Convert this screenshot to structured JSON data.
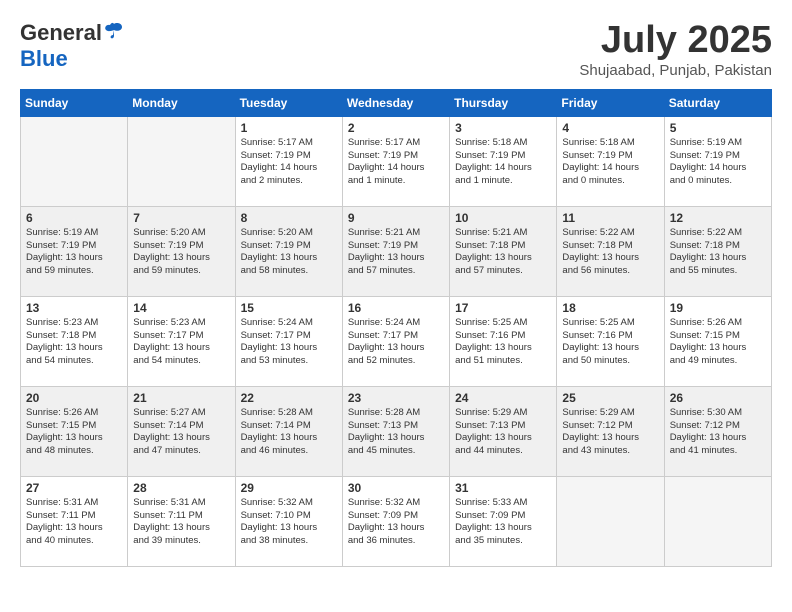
{
  "header": {
    "logo_line1": "General",
    "logo_line2": "Blue",
    "month_title": "July 2025",
    "location": "Shujaabad, Punjab, Pakistan"
  },
  "days_of_week": [
    "Sunday",
    "Monday",
    "Tuesday",
    "Wednesday",
    "Thursday",
    "Friday",
    "Saturday"
  ],
  "weeks": [
    [
      {
        "day": "",
        "info": ""
      },
      {
        "day": "",
        "info": ""
      },
      {
        "day": "1",
        "info": "Sunrise: 5:17 AM\nSunset: 7:19 PM\nDaylight: 14 hours\nand 2 minutes."
      },
      {
        "day": "2",
        "info": "Sunrise: 5:17 AM\nSunset: 7:19 PM\nDaylight: 14 hours\nand 1 minute."
      },
      {
        "day": "3",
        "info": "Sunrise: 5:18 AM\nSunset: 7:19 PM\nDaylight: 14 hours\nand 1 minute."
      },
      {
        "day": "4",
        "info": "Sunrise: 5:18 AM\nSunset: 7:19 PM\nDaylight: 14 hours\nand 0 minutes."
      },
      {
        "day": "5",
        "info": "Sunrise: 5:19 AM\nSunset: 7:19 PM\nDaylight: 14 hours\nand 0 minutes."
      }
    ],
    [
      {
        "day": "6",
        "info": "Sunrise: 5:19 AM\nSunset: 7:19 PM\nDaylight: 13 hours\nand 59 minutes."
      },
      {
        "day": "7",
        "info": "Sunrise: 5:20 AM\nSunset: 7:19 PM\nDaylight: 13 hours\nand 59 minutes."
      },
      {
        "day": "8",
        "info": "Sunrise: 5:20 AM\nSunset: 7:19 PM\nDaylight: 13 hours\nand 58 minutes."
      },
      {
        "day": "9",
        "info": "Sunrise: 5:21 AM\nSunset: 7:19 PM\nDaylight: 13 hours\nand 57 minutes."
      },
      {
        "day": "10",
        "info": "Sunrise: 5:21 AM\nSunset: 7:18 PM\nDaylight: 13 hours\nand 57 minutes."
      },
      {
        "day": "11",
        "info": "Sunrise: 5:22 AM\nSunset: 7:18 PM\nDaylight: 13 hours\nand 56 minutes."
      },
      {
        "day": "12",
        "info": "Sunrise: 5:22 AM\nSunset: 7:18 PM\nDaylight: 13 hours\nand 55 minutes."
      }
    ],
    [
      {
        "day": "13",
        "info": "Sunrise: 5:23 AM\nSunset: 7:18 PM\nDaylight: 13 hours\nand 54 minutes."
      },
      {
        "day": "14",
        "info": "Sunrise: 5:23 AM\nSunset: 7:17 PM\nDaylight: 13 hours\nand 54 minutes."
      },
      {
        "day": "15",
        "info": "Sunrise: 5:24 AM\nSunset: 7:17 PM\nDaylight: 13 hours\nand 53 minutes."
      },
      {
        "day": "16",
        "info": "Sunrise: 5:24 AM\nSunset: 7:17 PM\nDaylight: 13 hours\nand 52 minutes."
      },
      {
        "day": "17",
        "info": "Sunrise: 5:25 AM\nSunset: 7:16 PM\nDaylight: 13 hours\nand 51 minutes."
      },
      {
        "day": "18",
        "info": "Sunrise: 5:25 AM\nSunset: 7:16 PM\nDaylight: 13 hours\nand 50 minutes."
      },
      {
        "day": "19",
        "info": "Sunrise: 5:26 AM\nSunset: 7:15 PM\nDaylight: 13 hours\nand 49 minutes."
      }
    ],
    [
      {
        "day": "20",
        "info": "Sunrise: 5:26 AM\nSunset: 7:15 PM\nDaylight: 13 hours\nand 48 minutes."
      },
      {
        "day": "21",
        "info": "Sunrise: 5:27 AM\nSunset: 7:14 PM\nDaylight: 13 hours\nand 47 minutes."
      },
      {
        "day": "22",
        "info": "Sunrise: 5:28 AM\nSunset: 7:14 PM\nDaylight: 13 hours\nand 46 minutes."
      },
      {
        "day": "23",
        "info": "Sunrise: 5:28 AM\nSunset: 7:13 PM\nDaylight: 13 hours\nand 45 minutes."
      },
      {
        "day": "24",
        "info": "Sunrise: 5:29 AM\nSunset: 7:13 PM\nDaylight: 13 hours\nand 44 minutes."
      },
      {
        "day": "25",
        "info": "Sunrise: 5:29 AM\nSunset: 7:12 PM\nDaylight: 13 hours\nand 43 minutes."
      },
      {
        "day": "26",
        "info": "Sunrise: 5:30 AM\nSunset: 7:12 PM\nDaylight: 13 hours\nand 41 minutes."
      }
    ],
    [
      {
        "day": "27",
        "info": "Sunrise: 5:31 AM\nSunset: 7:11 PM\nDaylight: 13 hours\nand 40 minutes."
      },
      {
        "day": "28",
        "info": "Sunrise: 5:31 AM\nSunset: 7:11 PM\nDaylight: 13 hours\nand 39 minutes."
      },
      {
        "day": "29",
        "info": "Sunrise: 5:32 AM\nSunset: 7:10 PM\nDaylight: 13 hours\nand 38 minutes."
      },
      {
        "day": "30",
        "info": "Sunrise: 5:32 AM\nSunset: 7:09 PM\nDaylight: 13 hours\nand 36 minutes."
      },
      {
        "day": "31",
        "info": "Sunrise: 5:33 AM\nSunset: 7:09 PM\nDaylight: 13 hours\nand 35 minutes."
      },
      {
        "day": "",
        "info": ""
      },
      {
        "day": "",
        "info": ""
      }
    ]
  ]
}
